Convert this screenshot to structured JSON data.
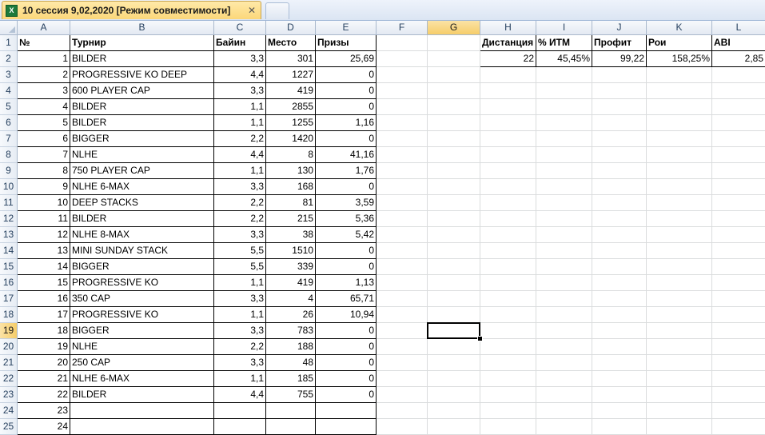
{
  "tab": {
    "title": "10 сессия 9,02,2020  [Режим совместимости]",
    "close": "✕"
  },
  "columns": [
    "A",
    "B",
    "C",
    "D",
    "E",
    "F",
    "G",
    "H",
    "I",
    "J",
    "K",
    "L"
  ],
  "selected_column": "G",
  "selected_row": 19,
  "rows_visible": [
    1,
    2,
    3,
    4,
    5,
    6,
    7,
    8,
    9,
    10,
    11,
    12,
    13,
    14,
    15,
    16,
    17,
    18,
    19,
    20,
    21,
    22,
    23,
    24,
    25
  ],
  "headers": {
    "num": "№",
    "tournament": "Турнир",
    "buyin": "Байин",
    "place": "Место",
    "prize": "Призы"
  },
  "table": [
    [
      "1",
      "BILDER",
      "3,3",
      "301",
      "25,69"
    ],
    [
      "2",
      "PROGRESSIVE KO DEEP",
      "4,4",
      "1227",
      "0"
    ],
    [
      "3",
      "600 PLAYER CAP",
      "3,3",
      "419",
      "0"
    ],
    [
      "4",
      "BILDER",
      "1,1",
      "2855",
      "0"
    ],
    [
      "5",
      "BILDER",
      "1,1",
      "1255",
      "1,16"
    ],
    [
      "6",
      "BIGGER",
      "2,2",
      "1420",
      "0"
    ],
    [
      "7",
      "NLHE",
      "4,4",
      "8",
      "41,16"
    ],
    [
      "8",
      "750 PLAYER CAP",
      "1,1",
      "130",
      "1,76"
    ],
    [
      "9",
      "NLHE 6-MAX",
      "3,3",
      "168",
      "0"
    ],
    [
      "10",
      "DEEP STACKS",
      "2,2",
      "81",
      "3,59"
    ],
    [
      "11",
      "BILDER",
      "2,2",
      "215",
      "5,36"
    ],
    [
      "12",
      "NLHE 8-MAX",
      "3,3",
      "38",
      "5,42"
    ],
    [
      "13",
      "MINI SUNDAY STACK",
      "5,5",
      "1510",
      "0"
    ],
    [
      "14",
      "BIGGER",
      "5,5",
      "339",
      "0"
    ],
    [
      "15",
      "PROGRESSIVE KO",
      "1,1",
      "419",
      "1,13"
    ],
    [
      "16",
      "350 CAP",
      "3,3",
      "4",
      "65,71"
    ],
    [
      "17",
      "PROGRESSIVE KO",
      "1,1",
      "26",
      "10,94"
    ],
    [
      "18",
      "BIGGER",
      "3,3",
      "783",
      "0"
    ],
    [
      "19",
      "NLHE",
      "2,2",
      "188",
      "0"
    ],
    [
      "20",
      "250 CAP",
      "3,3",
      "48",
      "0"
    ],
    [
      "21",
      "NLHE 6-MAX",
      "1,1",
      "185",
      "0"
    ],
    [
      "22",
      "BILDER",
      "4,4",
      "755",
      "0"
    ],
    [
      "23",
      "",
      "",
      "",
      ""
    ],
    [
      "24",
      "",
      "",
      "",
      ""
    ]
  ],
  "stats": {
    "headers": [
      "Дистанция",
      "% ИТМ",
      "Профит",
      "Рои",
      "ABI"
    ],
    "values": [
      "22",
      "45,45%",
      "99,22",
      "158,25%",
      "2,85"
    ]
  }
}
